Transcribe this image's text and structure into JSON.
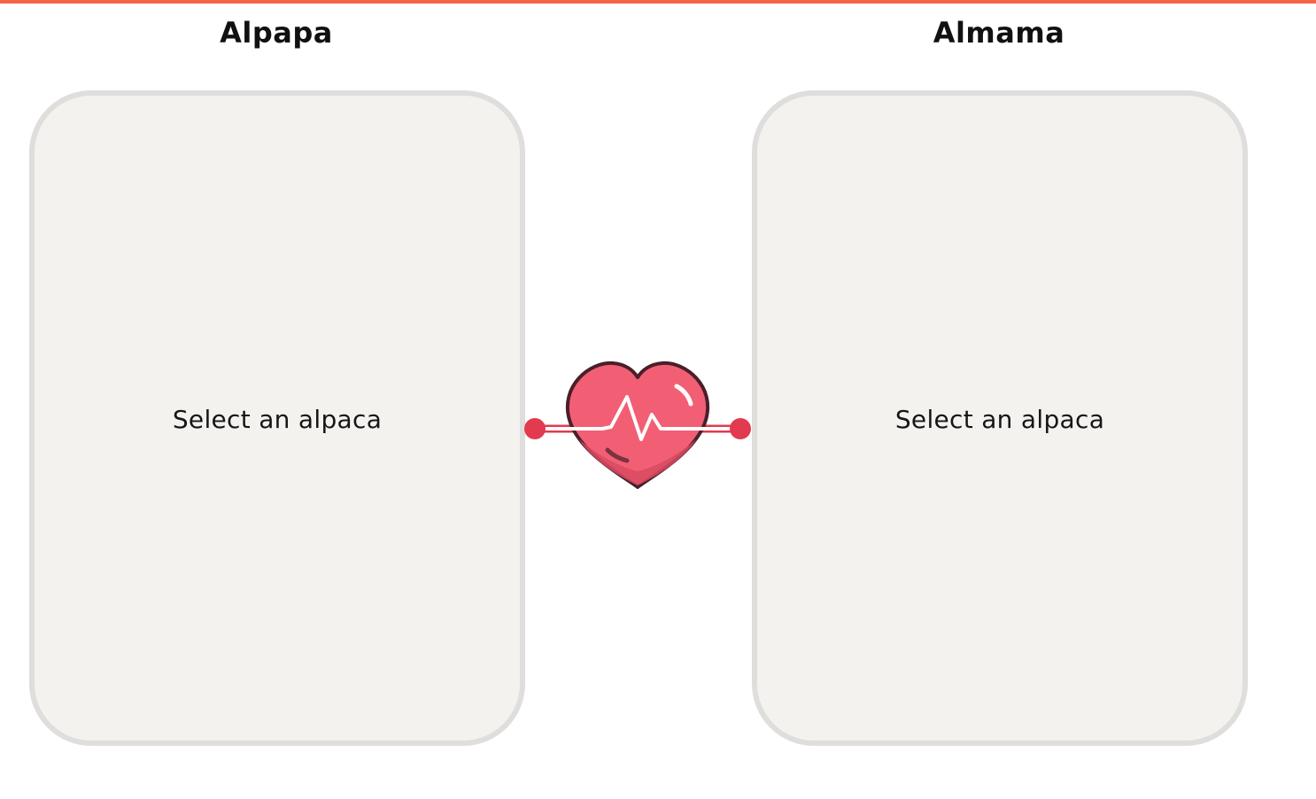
{
  "header": {
    "accent_color": "#f26646"
  },
  "pair": {
    "left": {
      "title": "Alpapa",
      "prompt": "Select an alpaca"
    },
    "right": {
      "title": "Almama",
      "prompt": "Select an alpaca"
    },
    "connector_icon": "heart-pulse-icon"
  },
  "colors": {
    "card_fill": "#f3f2ef",
    "card_border": "#dfdedc",
    "heart": "#f25f74",
    "heart_outline": "#4a1f2a",
    "connector_dot": "#e23a4f"
  }
}
